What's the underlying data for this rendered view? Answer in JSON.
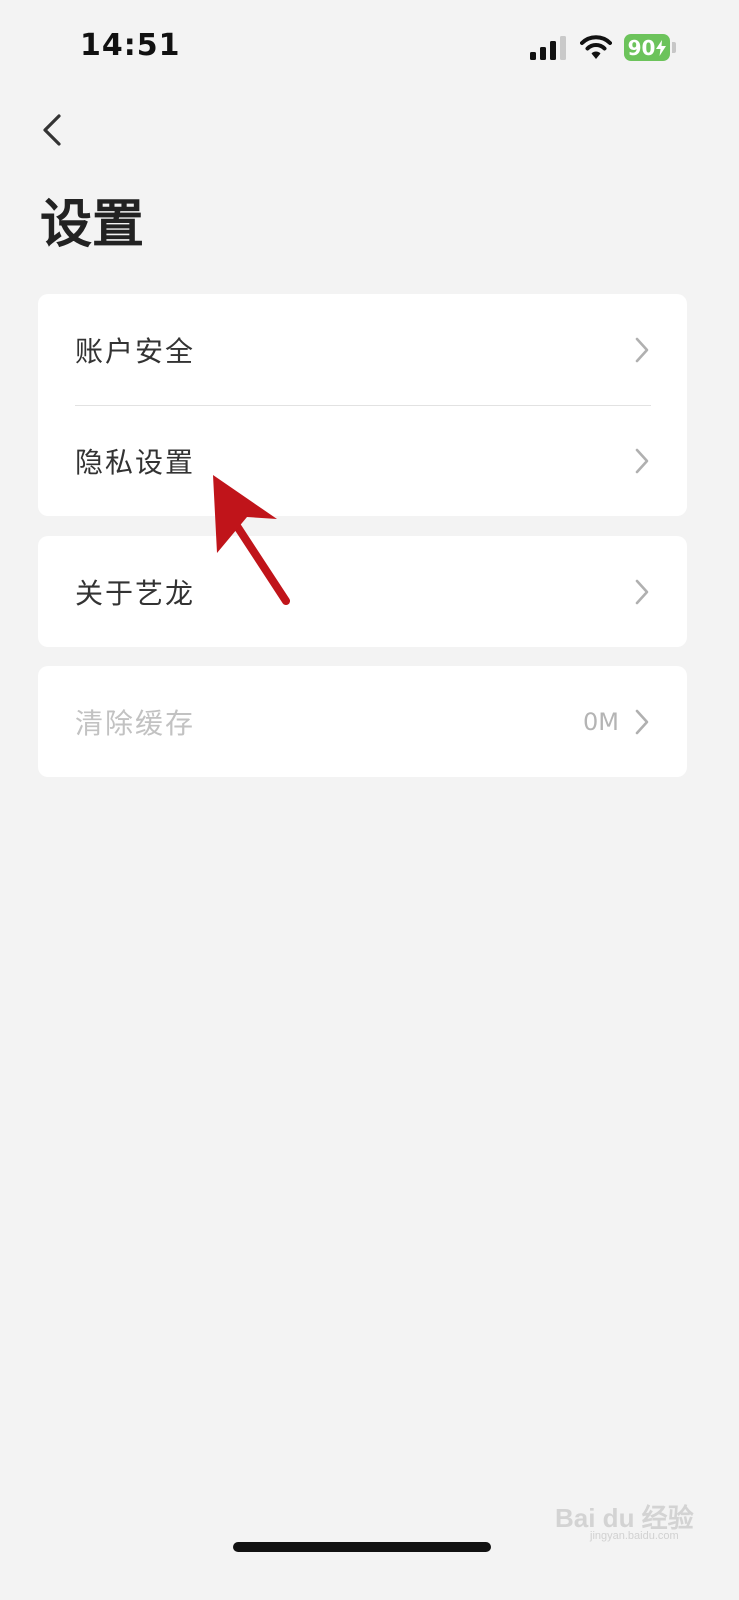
{
  "status_bar": {
    "time": "14:51",
    "battery": "90",
    "battery_color": "#6cc35b"
  },
  "header": {
    "back_icon": "chevron-left-icon",
    "title": "设置"
  },
  "groups": [
    {
      "items": [
        {
          "label": "账户安全",
          "icon": "chevron-right-icon"
        },
        {
          "label": "隐私设置",
          "icon": "chevron-right-icon"
        }
      ]
    },
    {
      "items": [
        {
          "label": "关于艺龙",
          "icon": "chevron-right-icon"
        }
      ]
    },
    {
      "items": [
        {
          "label": "清除缓存",
          "value": "0M",
          "icon": "chevron-right-icon"
        }
      ]
    }
  ],
  "annotation": {
    "arrow_color": "#c0141a"
  },
  "watermark": {
    "brand": "Bai du 经验",
    "domain": "jingyan.baidu.com"
  }
}
